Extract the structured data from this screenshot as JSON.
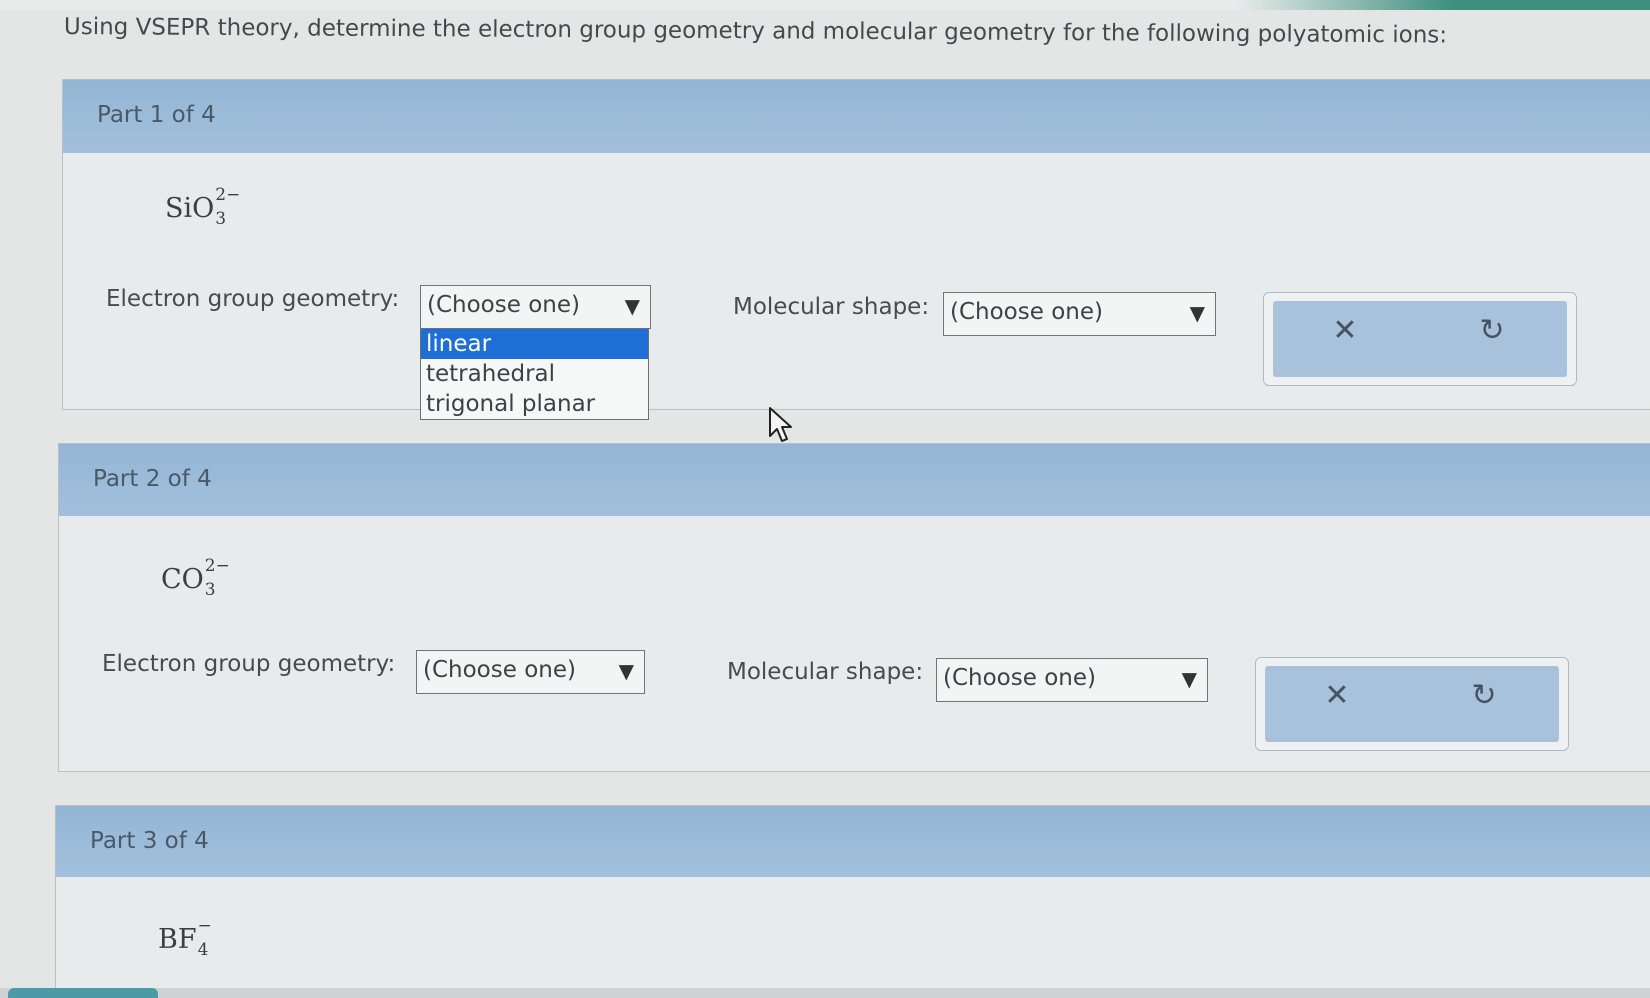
{
  "question": "Using VSEPR theory, determine the electron group geometry and molecular geometry for the following polyatomic ions:",
  "parts": [
    {
      "title": "Part 1 of 4",
      "formula": {
        "base": "SiO",
        "sub": "3",
        "sup": "2−"
      },
      "electron_label": "Electron group geometry:",
      "electron_select": "(Choose one)",
      "molecular_label": "Molecular shape:",
      "molecular_select": "(Choose one)",
      "dropdown_options": [
        "linear",
        "tetrahedral",
        "trigonal planar"
      ],
      "dropdown_highlighted": "linear"
    },
    {
      "title": "Part 2 of 4",
      "formula": {
        "base": "CO",
        "sub": "3",
        "sup": "2−"
      },
      "electron_label": "Electron group geometry:",
      "electron_select": "(Choose one)",
      "molecular_label": "Molecular shape:",
      "molecular_select": "(Choose one)"
    },
    {
      "title": "Part 3 of 4",
      "formula": {
        "base": "BF",
        "sub": "4",
        "sup": "−"
      }
    }
  ],
  "icons": {
    "clear": "close-icon",
    "undo": "undo-icon",
    "arrow": "dropdown-arrow-icon",
    "cursor": "mouse-cursor-icon"
  }
}
